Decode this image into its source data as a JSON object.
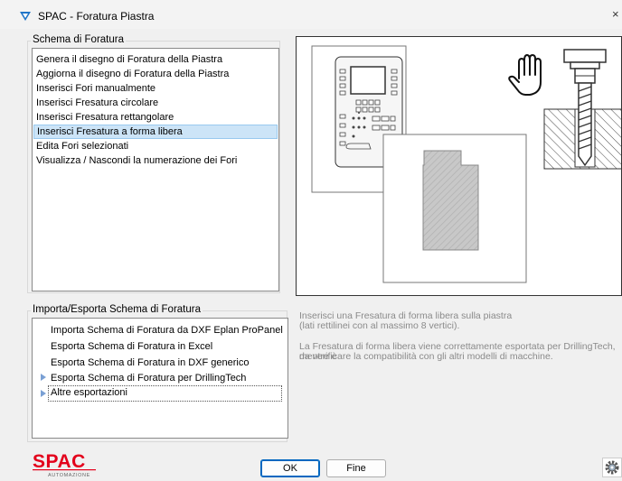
{
  "window": {
    "title": "SPAC - Foratura Piastra",
    "close": "×"
  },
  "schema_group": {
    "label": "Schema di Foratura",
    "items": [
      "Genera il disegno di Foratura della Piastra",
      "Aggiorna il disegno di Foratura della Piastra",
      "Inserisci Fori manualmente",
      "Inserisci Fresatura circolare",
      "Inserisci Fresatura rettangolare",
      "Inserisci Fresatura a forma libera",
      "Edita Fori selezionati",
      "Visualizza / Nascondi la numerazione dei Fori"
    ],
    "selected": "Inserisci Fresatura a forma libera"
  },
  "export_group": {
    "label": "Importa/Esporta Schema di Foratura",
    "items": [
      "Importa Schema di Foratura da DXF Eplan ProPanel",
      "Esporta Schema di Foratura in Excel",
      "Esporta Schema di Foratura in DXF generico",
      "Esporta Schema di Foratura per DrillingTech",
      "Altre esportazioni"
    ]
  },
  "description": {
    "line1": "Inserisci una Fresatura di forma libera sulla piastra",
    "line2": "(lati rettilinei con al massimo 8 vertici).",
    "line3": "La Fresatura di forma libera viene correttamente esportata per DrillingTech, mentre è",
    "line4": "da verificare la compatibilità con gli altri modelli di macchine."
  },
  "buttons": {
    "ok": "OK",
    "fine": "Fine"
  },
  "logo": {
    "brand": "SPAC",
    "subtitle": "AUTOMAZIONE"
  },
  "colors": {
    "brand_red": "#e3001b",
    "selection": "#cce4f7",
    "accent": "#0067c0"
  }
}
